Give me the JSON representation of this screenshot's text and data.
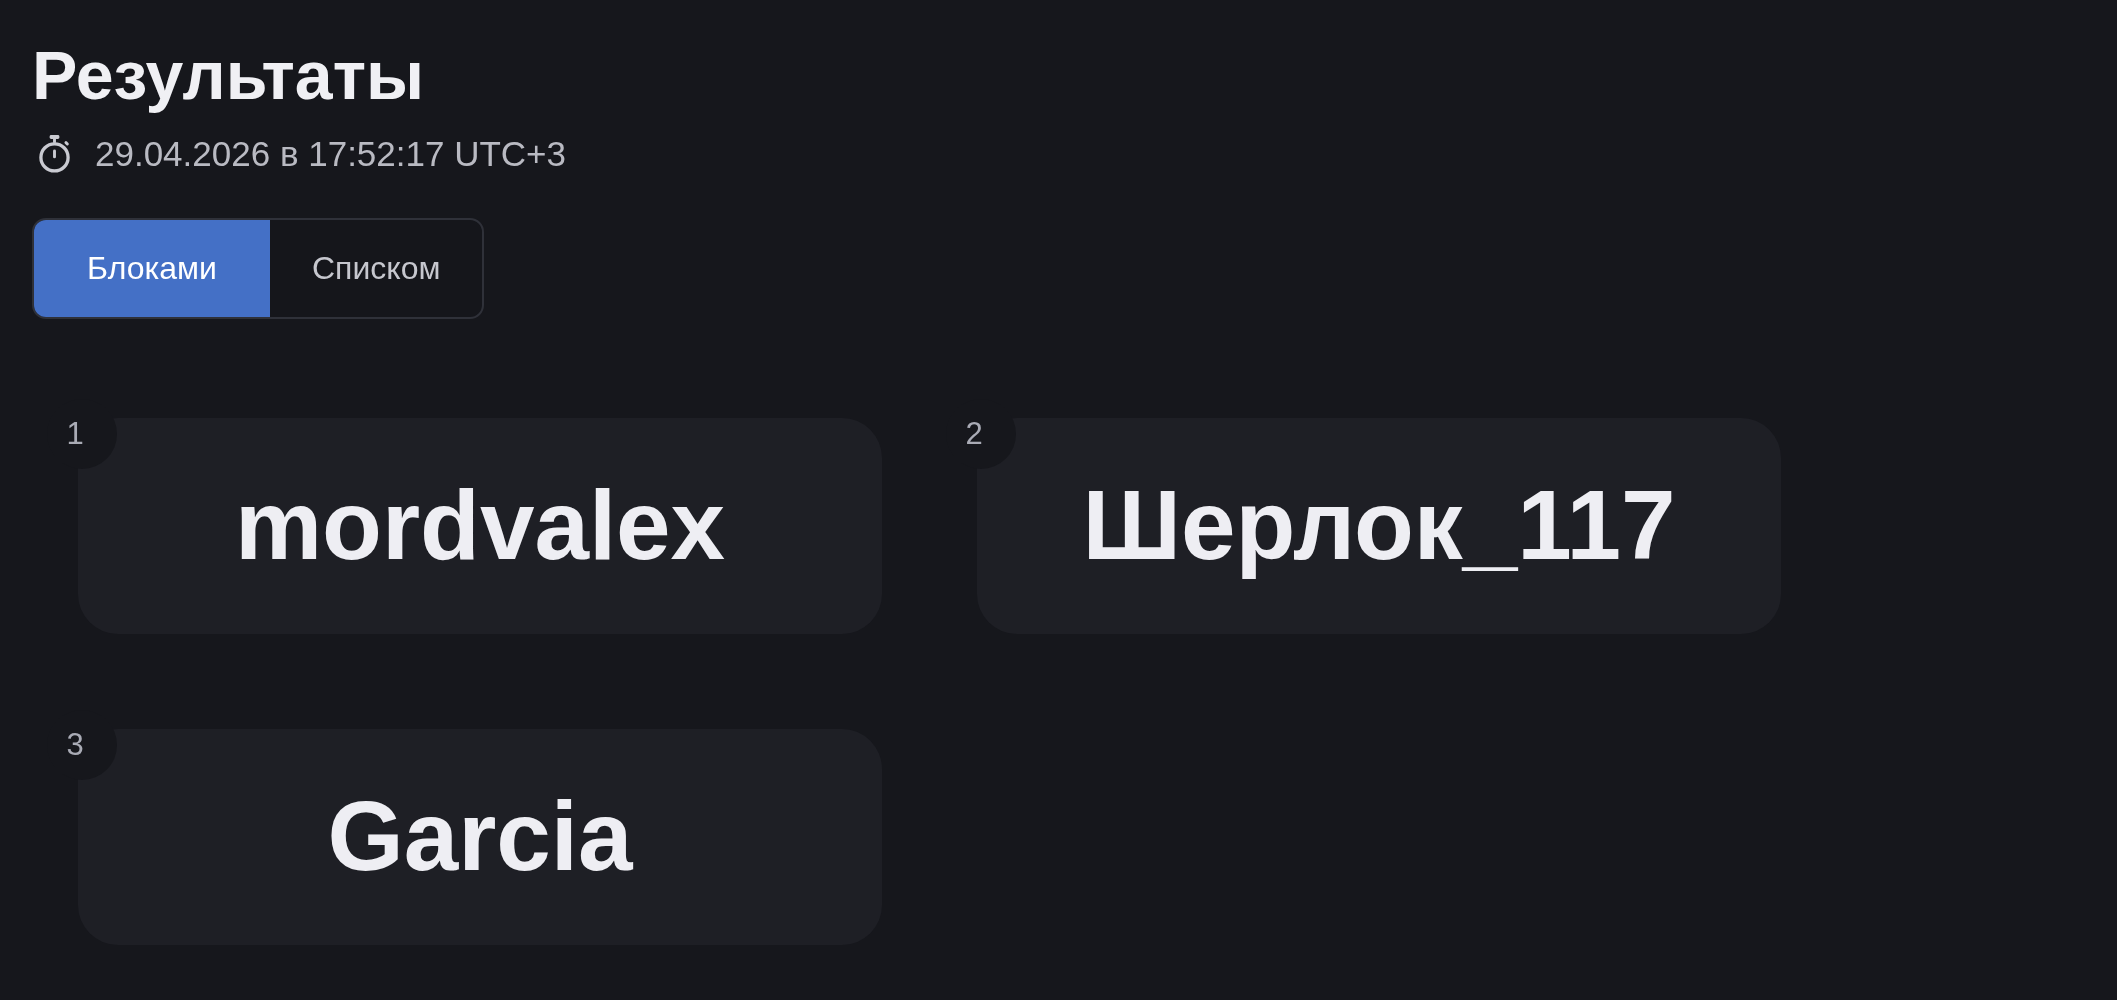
{
  "title": "Результаты",
  "timestamp": "29.04.2026 в 17:52:17 UTC+3",
  "view_toggle": [
    {
      "label": "Блоками",
      "selected": true
    },
    {
      "label": "Списком",
      "selected": false
    }
  ],
  "results": [
    {
      "rank": "1",
      "name": "mordvalex"
    },
    {
      "rank": "2",
      "name": "Шерлок_117"
    },
    {
      "rank": "3",
      "name": "Garcia"
    }
  ]
}
